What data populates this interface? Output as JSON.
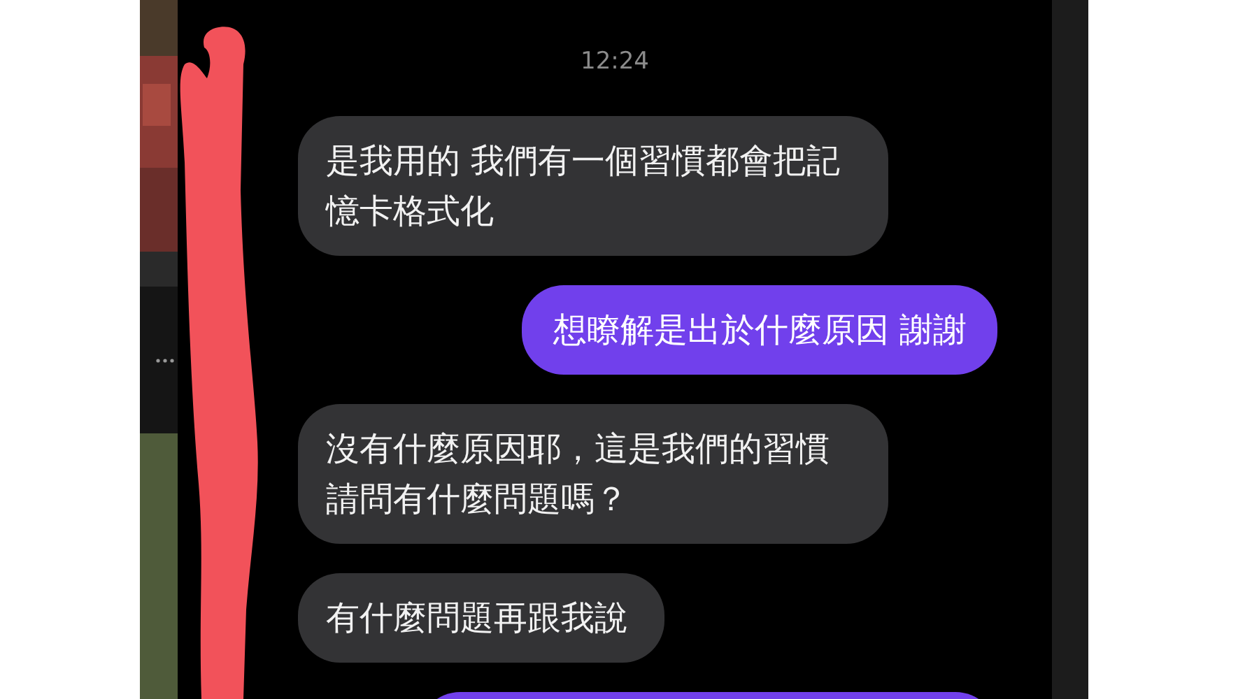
{
  "chat": {
    "time": "12:24",
    "messages": [
      {
        "kind": "received",
        "text": "是我用的 我們有一個習慣都會把記憶卡格式化"
      },
      {
        "kind": "sent",
        "text": "想瞭解是出於什麼原因 謝謝"
      },
      {
        "kind": "received",
        "text": "沒有什麼原因耶，這是我們的習慣請問有什麼問題嗎？"
      },
      {
        "kind": "received",
        "text": "有什麼問題再跟我說"
      }
    ],
    "cut_off_bubble": {
      "kind": "sent"
    }
  }
}
